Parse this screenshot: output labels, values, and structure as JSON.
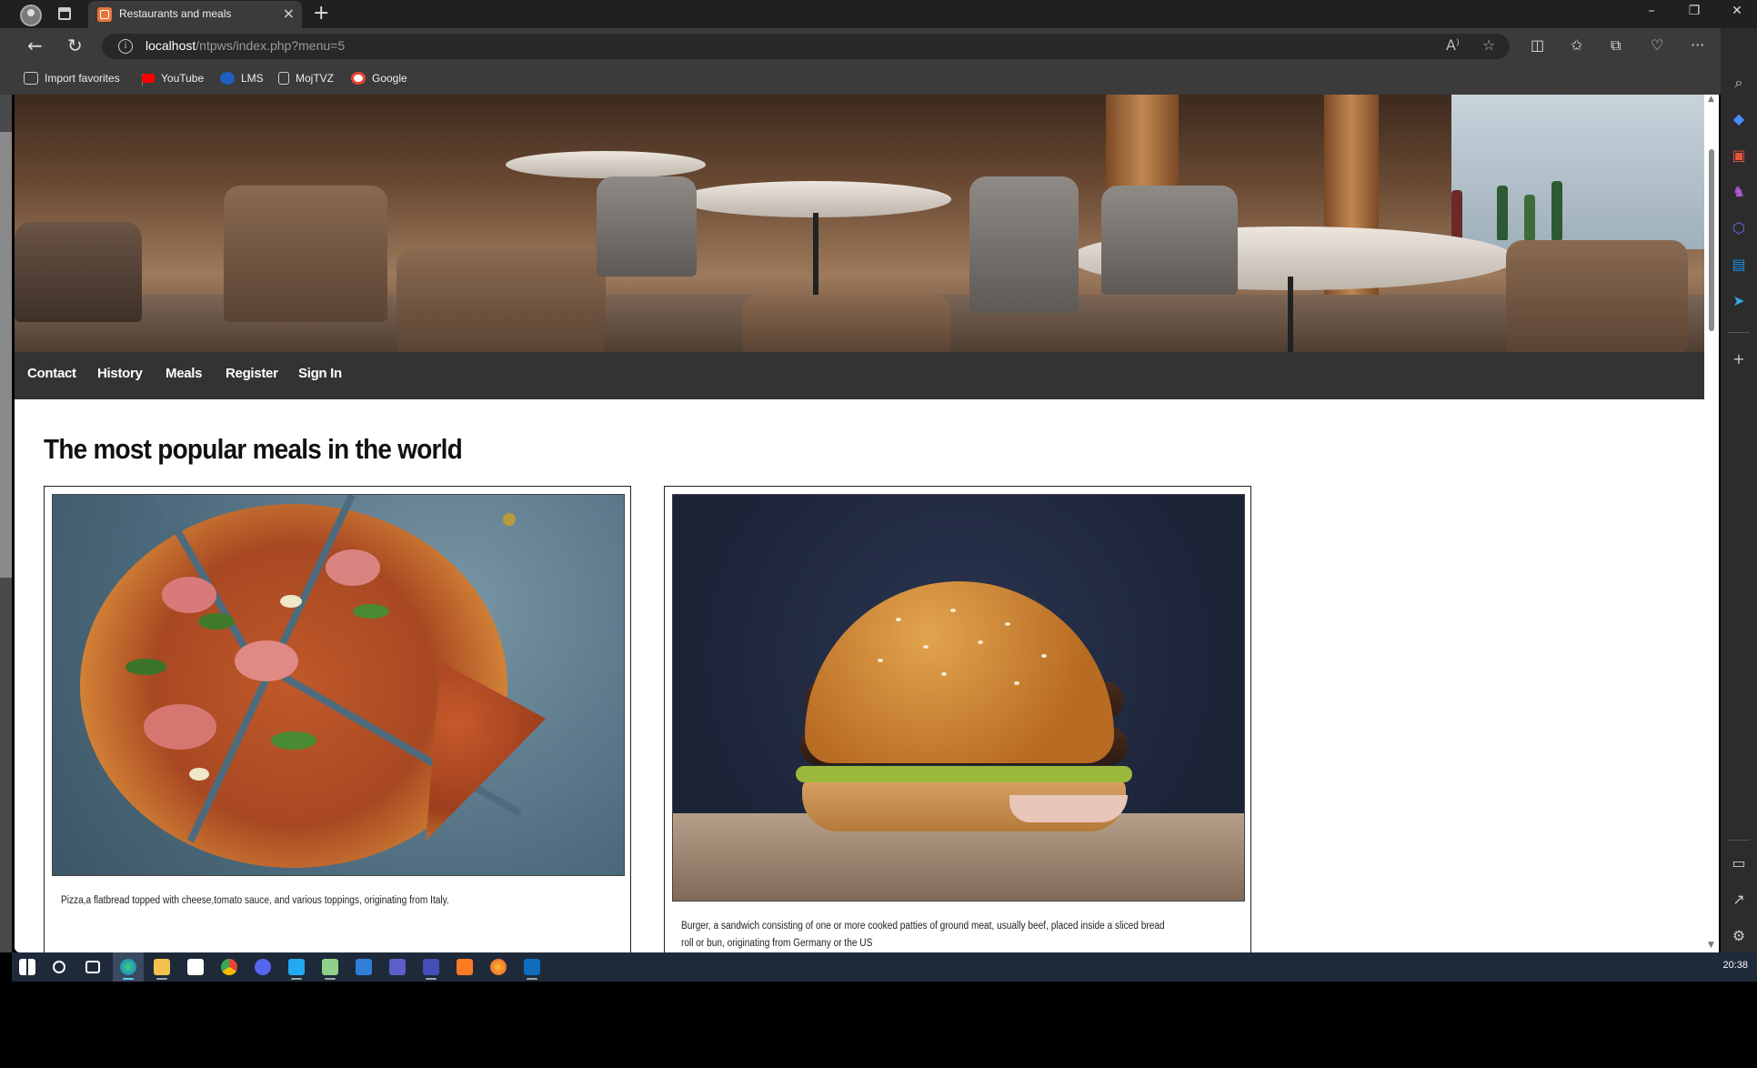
{
  "browser": {
    "tab_title": "Restaurants and meals",
    "url_host": "localhost",
    "url_path": "/ntpws/index.php?menu=5",
    "favorites": [
      {
        "label": "Import favorites",
        "icon": "import-favorites-icon",
        "color": "#cfcfcf"
      },
      {
        "label": "YouTube",
        "icon": "youtube-icon",
        "color": "#ff0000"
      },
      {
        "label": "LMS",
        "icon": "lms-icon",
        "color": "#1f5fbf"
      },
      {
        "label": "MojTVZ",
        "icon": "page-icon",
        "color": "#cfcfcf"
      },
      {
        "label": "Google",
        "icon": "google-icon",
        "color": "#ffffff"
      }
    ]
  },
  "site": {
    "nav": [
      "Contact",
      "History",
      "Meals",
      "Register",
      "Sign In"
    ],
    "heading": "The most popular meals in the world",
    "cards": [
      {
        "name": "pizza",
        "description": "Pizza,a flatbread topped with cheese,tomato sauce, and various toppings, originating from Italy."
      },
      {
        "name": "burger",
        "description": "Burger, a sandwich consisting of one or more cooked patties of ground meat, usually beef, placed inside a sliced bread roll or bun, originating from Germany or the US"
      }
    ]
  },
  "taskbar": {
    "clock": "20:38",
    "apps": [
      "windows-start-icon",
      "search-icon",
      "task-view-icon",
      "edge-icon",
      "file-explorer-icon",
      "store-icon",
      "chrome-icon",
      "discord-icon",
      "vscode-icon",
      "notepad-icon",
      "mail-icon",
      "teams-icon",
      "teams-classic-icon",
      "xampp-icon",
      "firefox-icon",
      "outlook-icon"
    ]
  },
  "colors": {
    "nav_bg": "#333333",
    "accent": "#60cdff",
    "page_bg": "#ffffff"
  }
}
